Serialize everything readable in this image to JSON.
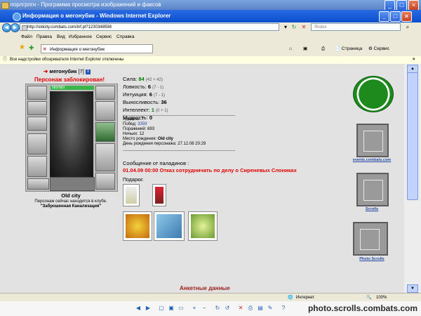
{
  "viewer": {
    "title": "лорлгрлгн - Программа просмотра изображений и факсов",
    "watermark": "photo.scrolls.combats.com"
  },
  "ie": {
    "title": "Информация о мегонубик - Windows Internet Explorer",
    "address": "http://oldcity.combats.com/inf.pl?1230348598",
    "search_placeholder": "Яndex"
  },
  "menu": [
    "Файл",
    "Правка",
    "Вид",
    "Избранное",
    "Сервис",
    "Справка"
  ],
  "tab": {
    "label": "Информация о мегонубик",
    "page_menu": "Страница",
    "tools_menu": "Сервис"
  },
  "infobar": "Все надстройки обозревателя Internet Explorer отключены",
  "character": {
    "name": "мегонубик",
    "level": "[7]",
    "blocked": "Персонаж заблокирован!",
    "hp": "583/583",
    "hp_fraction": 1.0,
    "location_name": "Old city",
    "location_text": "Персонаж сейчас находится в клубе.",
    "location_club": "\"Заброшенная Канализация\""
  },
  "stats": [
    {
      "label": "Сила:",
      "value": "84",
      "extra": "(42 + 42)",
      "green": true
    },
    {
      "label": "Ловкость:",
      "value": "6",
      "extra": "(7 - 1)",
      "green": false
    },
    {
      "label": "Интуиция:",
      "value": "6",
      "extra": "(7 - 1)",
      "green": false
    },
    {
      "label": "Выносливость:",
      "value": "36",
      "extra": "",
      "green": false
    },
    {
      "label": "Интеллект:",
      "value": "1",
      "extra": "(0 + 1)",
      "green": true
    },
    {
      "label": "Мудрость:",
      "value": "0",
      "extra": "",
      "green": false
    }
  ],
  "info": {
    "level_line": "Уровень: 7",
    "wins_label": "Побед:",
    "wins": "3359",
    "losses": "Поражений: 693",
    "draws": "Ничьих: 12",
    "birthplace_label": "Место рождения:",
    "birthplace": "Old city",
    "birthday": "День рождения персонажа: 27.12.08 20:29"
  },
  "message": {
    "title": "Сообщение от паладинов :",
    "text": "01.04.09 00:00 Отказ сотрудничать по делу о Сиреневых Слониках"
  },
  "gifts_label": "Подарки:",
  "profile_title": "Анкетные данные",
  "badges": {
    "events_label": "events.combats.com",
    "scrolls_label": "Scrolls",
    "photo_label": "Photo Scrolls"
  },
  "status": {
    "zone": "Интернет",
    "zoom": "100%"
  },
  "colors": {
    "blocked": "#e00000",
    "page_bg": "#e2e2e2",
    "link": "#2447a3"
  }
}
